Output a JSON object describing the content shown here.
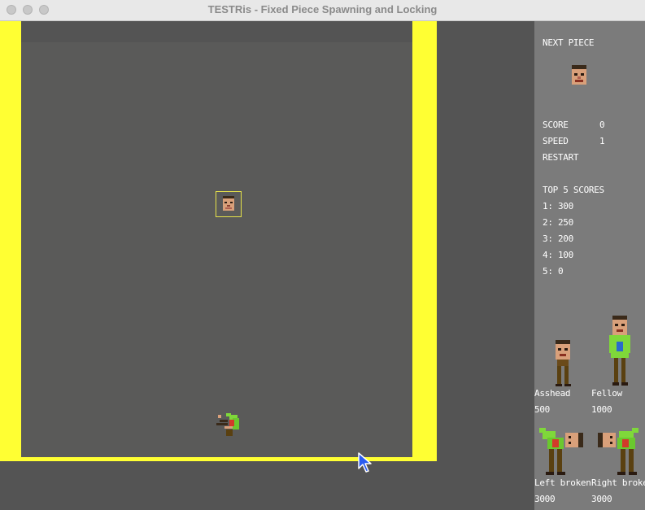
{
  "window": {
    "title": "TESTRis - Fixed Piece Spawning and Locking"
  },
  "panel": {
    "next_piece_label": "NEXT PIECE",
    "score_label": "SCORE",
    "score_value": "0",
    "speed_label": "SPEED",
    "speed_value": "1",
    "restart_label": "RESTART",
    "top_scores_label": "TOP 5 SCORES",
    "top_scores": [
      "1: 300",
      "2: 250",
      "3: 200",
      "4: 100",
      "5: 0"
    ],
    "legend": [
      {
        "name": "Asshead",
        "points": "500"
      },
      {
        "name": "Fellow",
        "points": "1000"
      },
      {
        "name": "Left broken",
        "points": "3000"
      },
      {
        "name": "Right broke",
        "points": "3000"
      }
    ]
  },
  "colors": {
    "wall": "#ffff33",
    "board": "#5a5a59",
    "panel": "#7b7b7b",
    "outside": "#545454"
  },
  "icons": {
    "next_piece": "head-icon",
    "falling_piece": "head-icon",
    "locked_piece": "broken-body-icon"
  }
}
